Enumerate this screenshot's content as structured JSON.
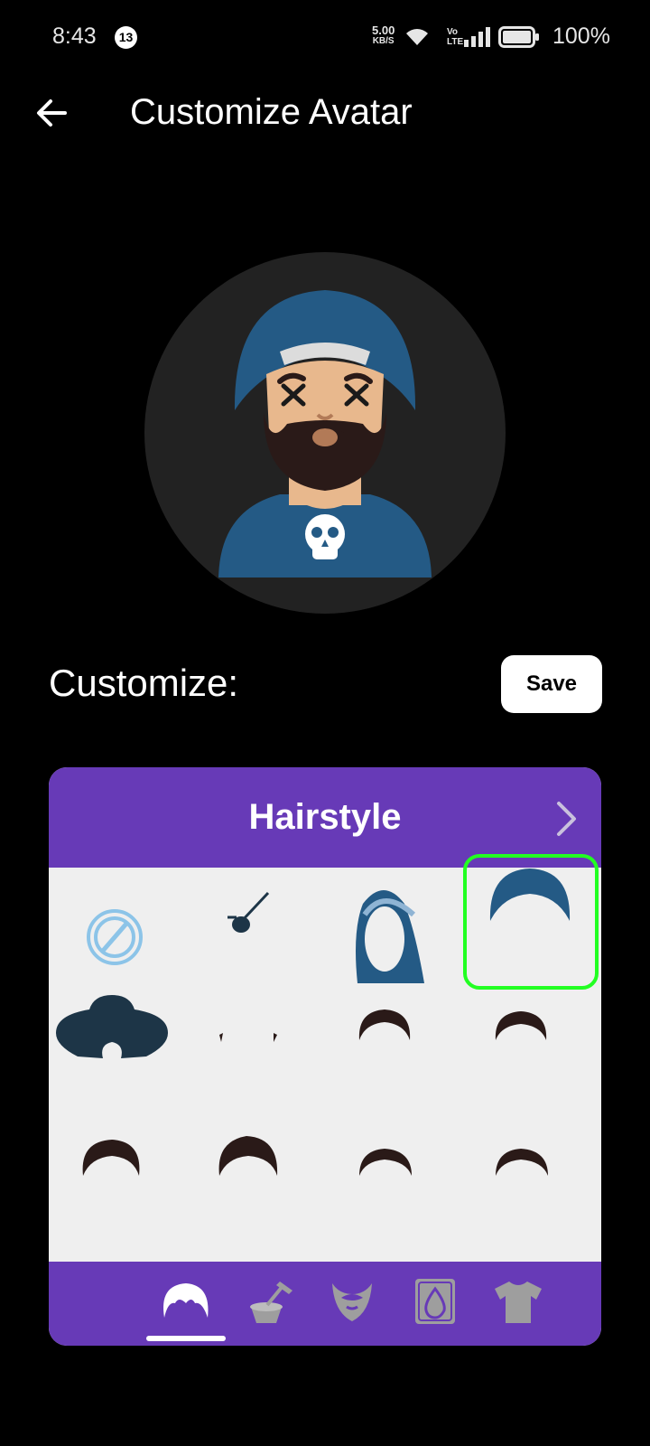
{
  "status_bar": {
    "time": "8:43",
    "notification_count": "13",
    "net_speed_value": "5.00",
    "net_speed_unit": "KB/S",
    "volte_top": "Vo",
    "volte_bottom": "LTE",
    "battery": "100%"
  },
  "header": {
    "title": "Customize Avatar"
  },
  "customize": {
    "label": "Customize:",
    "save_label": "Save"
  },
  "panel": {
    "title": "Hairstyle",
    "items": [
      {
        "icon": "none-icon"
      },
      {
        "icon": "eyepatch-icon"
      },
      {
        "icon": "hijab-icon"
      },
      {
        "icon": "turban-icon",
        "selected": true
      },
      {
        "icon": "hat-icon"
      },
      {
        "icon": "side-hair-icon"
      },
      {
        "icon": "short-hair-icon"
      },
      {
        "icon": "short-hair-icon"
      },
      {
        "icon": "wavy-hair-icon"
      },
      {
        "icon": "quiff-hair-icon"
      },
      {
        "icon": "crew-hair-icon"
      },
      {
        "icon": "crew-hair-icon"
      }
    ],
    "tabs": [
      {
        "icon": "hairstyle-icon",
        "active": true
      },
      {
        "icon": "hair-color-icon"
      },
      {
        "icon": "beard-icon"
      },
      {
        "icon": "skin-tone-icon"
      },
      {
        "icon": "shirt-icon"
      }
    ]
  },
  "colors": {
    "accent": "#673ab7",
    "selected_border": "#22ff22",
    "turban": "#245a85",
    "skin": "#e8b88d",
    "hair": "#2a1a18"
  }
}
